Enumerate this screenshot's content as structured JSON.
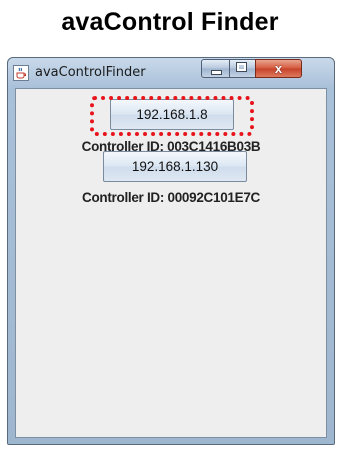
{
  "document": {
    "title": "avaControl Finder"
  },
  "window": {
    "title": "avaControlFinder",
    "app_icon": "java-cup-icon",
    "controls": {
      "minimize": "minimize-icon",
      "maximize": "maximize-icon",
      "close": "close-icon",
      "close_glyph": "x"
    }
  },
  "controllers": [
    {
      "ip": "192.168.1.8",
      "id_label": "Controller ID: 003C1416B03B"
    },
    {
      "ip": "192.168.1.130",
      "id_label": "Controller ID: 00092C101E7C"
    }
  ],
  "highlight": {
    "color": "#e8141b",
    "style": "dotted"
  }
}
